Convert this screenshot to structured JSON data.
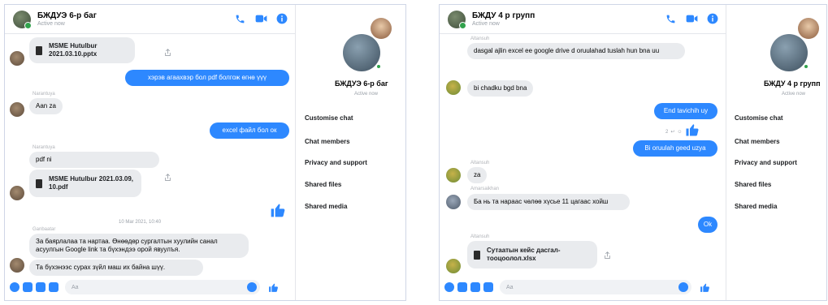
{
  "left": {
    "header": {
      "name": "БЖДУЭ 6-р бaг",
      "status": "Active now"
    },
    "messages": {
      "file1": "MSME Hutulbur 2021.03.10.pptx",
      "out1": "хэрэв агаахвэр бол pdf болгож өгнө үүү",
      "sender_a": "Narantuya",
      "in1": "Aan za",
      "out2": "excel файл бол ок",
      "sender_b": "Narantuya",
      "in2": "pdf ni",
      "file2": "MSME Hutulbur 2021.03.09, 10.pdf",
      "timestamp": "10 Mar 2021, 10:40",
      "sender_c": "Ganbaatar",
      "in3": "За баярлалаа та нартаа. Өнөөдөр сургалтын хуулийн санал асуулгын Google link та бүхэндээ орой явуулъя.",
      "in4": "Та бүхэнээс сурах зүйл маш их байна шүү."
    },
    "composer": {
      "placeholder": "Aa"
    },
    "sidebar": {
      "name": "БЖДУЭ 6-р бaг",
      "status": "Active now",
      "items": [
        "Customise chat",
        "Chat members",
        "Privacy and support",
        "Shared files",
        "Shared media"
      ]
    }
  },
  "right": {
    "header": {
      "name": "БЖДУ 4 р групп",
      "status": "Active now"
    },
    "messages": {
      "sender_a": "Altansuh",
      "in1": "dasgal ajlin excel ee google drive d oruulahad tuslah hun bna uu",
      "in2": "bi chadku bgd bna",
      "out1": "End tavichih uy",
      "reactions": "2",
      "out2": "Bi oruulah geed uzya",
      "sender_b": "Altansuh",
      "in3": "za",
      "sender_c": "Amarsaikhan",
      "in4": "Ба нь та нарaас чөлөө хүсье 11 цагаас хойш",
      "out3": "Ok",
      "sender_d": "Altansuh",
      "file1": "Сутаатын кейс дасгал-тооцоолол.xlsx"
    },
    "composer": {
      "placeholder": "Aa"
    },
    "sidebar": {
      "name": "БЖДУ 4 р групп",
      "status": "Active now",
      "items": [
        "Customise chat",
        "Chat members",
        "Privacy and support",
        "Shared files",
        "Shared media"
      ]
    }
  },
  "colors": {
    "accent": "#2d88ff",
    "incoming": "#e9ebee",
    "online": "#31a24c"
  },
  "icons": [
    "phone-icon",
    "video-icon",
    "info-icon",
    "share-icon",
    "like-icon",
    "plus-icon",
    "image-icon",
    "sticker-icon",
    "gif-icon",
    "emoji-icon",
    "file-icon"
  ]
}
